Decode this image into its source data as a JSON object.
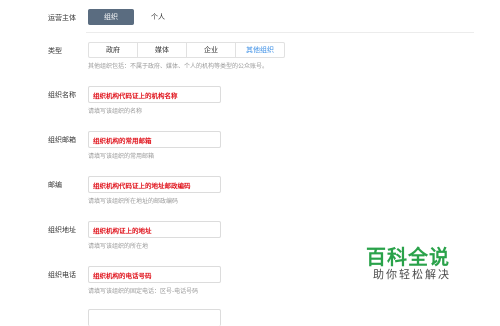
{
  "operating_subject": {
    "label": "运营主体",
    "options": [
      "组织",
      "个人"
    ],
    "selected": "组织"
  },
  "type": {
    "label": "类型",
    "options": [
      "政府",
      "媒体",
      "企业",
      "其他组织"
    ],
    "selected": "其他组织",
    "hint": "其他组织包括：不属于政府、媒体、个人的机构等类型的公众账号。"
  },
  "fields": [
    {
      "label": "组织名称",
      "value": "组织机构代码证上的机构名称",
      "hint": "请填写该组织的名称"
    },
    {
      "label": "组织邮箱",
      "value": "组织机构的常用邮箱",
      "hint": "请填写该组织的常用邮箱"
    },
    {
      "label": "邮编",
      "value": "组织机构代码证上的地址邮政编码",
      "hint": "请填写该组织所在地址的邮政编码"
    },
    {
      "label": "组织地址",
      "value": "组织机构证上的地址",
      "hint": "请填写该组织的所在地"
    },
    {
      "label": "组织电话",
      "value": "组织机构的电话号码",
      "hint": "请填写该组织的固定电话：区号-电话号码"
    }
  ],
  "watermark": {
    "title": "百科全说",
    "subtitle": "助你轻松解决"
  },
  "colors": {
    "selected_bg": "#5a6c80",
    "active_text": "#3a8ee6",
    "annotation_red": "#e0141d",
    "watermark_green": "#2aa24a"
  }
}
